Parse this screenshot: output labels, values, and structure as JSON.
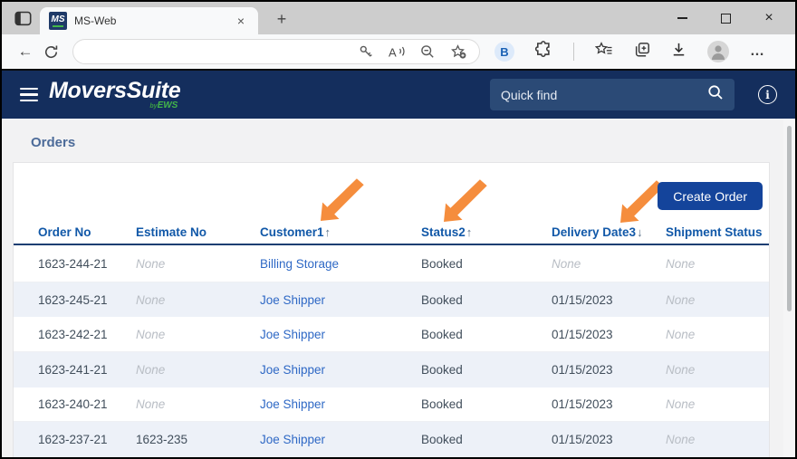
{
  "browser": {
    "tab": {
      "title": "MS-Web",
      "favicon_text": "MS"
    },
    "close_tab_glyph": "×",
    "new_tab_glyph": "+",
    "back_glyph": "←",
    "address_bar": {
      "value": ""
    },
    "bing_label": "B",
    "more_glyph": "…",
    "window_controls": {
      "close_glyph": "×"
    }
  },
  "header": {
    "logo": {
      "brand": "MoversSuite",
      "by": "by",
      "company": "EWS"
    },
    "quick_find": {
      "placeholder": "Quick find"
    },
    "info_glyph": "i"
  },
  "page": {
    "title": "Orders",
    "create_order_label": "Create Order"
  },
  "table": {
    "columns": [
      {
        "label": "Order No",
        "sort": ""
      },
      {
        "label": "Estimate No",
        "sort": ""
      },
      {
        "label": "Customer1",
        "sort": "↑"
      },
      {
        "label": "Status2",
        "sort": "↑"
      },
      {
        "label": "Delivery Date3",
        "sort": "↓"
      },
      {
        "label": "Shipment Status",
        "sort": ""
      }
    ],
    "rows": [
      {
        "order_no": "1623-244-21",
        "estimate_no": "None",
        "customer": "Billing Storage",
        "status": "Booked",
        "delivery_date": "None",
        "shipment_status": "None"
      },
      {
        "order_no": "1623-245-21",
        "estimate_no": "None",
        "customer": "Joe Shipper",
        "status": "Booked",
        "delivery_date": "01/15/2023",
        "shipment_status": "None"
      },
      {
        "order_no": "1623-242-21",
        "estimate_no": "None",
        "customer": "Joe Shipper",
        "status": "Booked",
        "delivery_date": "01/15/2023",
        "shipment_status": "None"
      },
      {
        "order_no": "1623-241-21",
        "estimate_no": "None",
        "customer": "Joe Shipper",
        "status": "Booked",
        "delivery_date": "01/15/2023",
        "shipment_status": "None"
      },
      {
        "order_no": "1623-240-21",
        "estimate_no": "None",
        "customer": "Joe Shipper",
        "status": "Booked",
        "delivery_date": "01/15/2023",
        "shipment_status": "None"
      },
      {
        "order_no": "1623-237-21",
        "estimate_no": "1623-235",
        "customer": "Joe Shipper",
        "status": "Booked",
        "delivery_date": "01/15/2023",
        "shipment_status": "None"
      }
    ]
  },
  "colors": {
    "header_navy": "#142e5d",
    "button_blue": "#14449b",
    "link_blue": "#2e68c5",
    "column_header_blue": "#1158a8",
    "annotation_orange": "#f58d3d",
    "logo_green": "#43b649",
    "stripe": "#edf1f8",
    "muted_text": "#b8bdc4"
  }
}
